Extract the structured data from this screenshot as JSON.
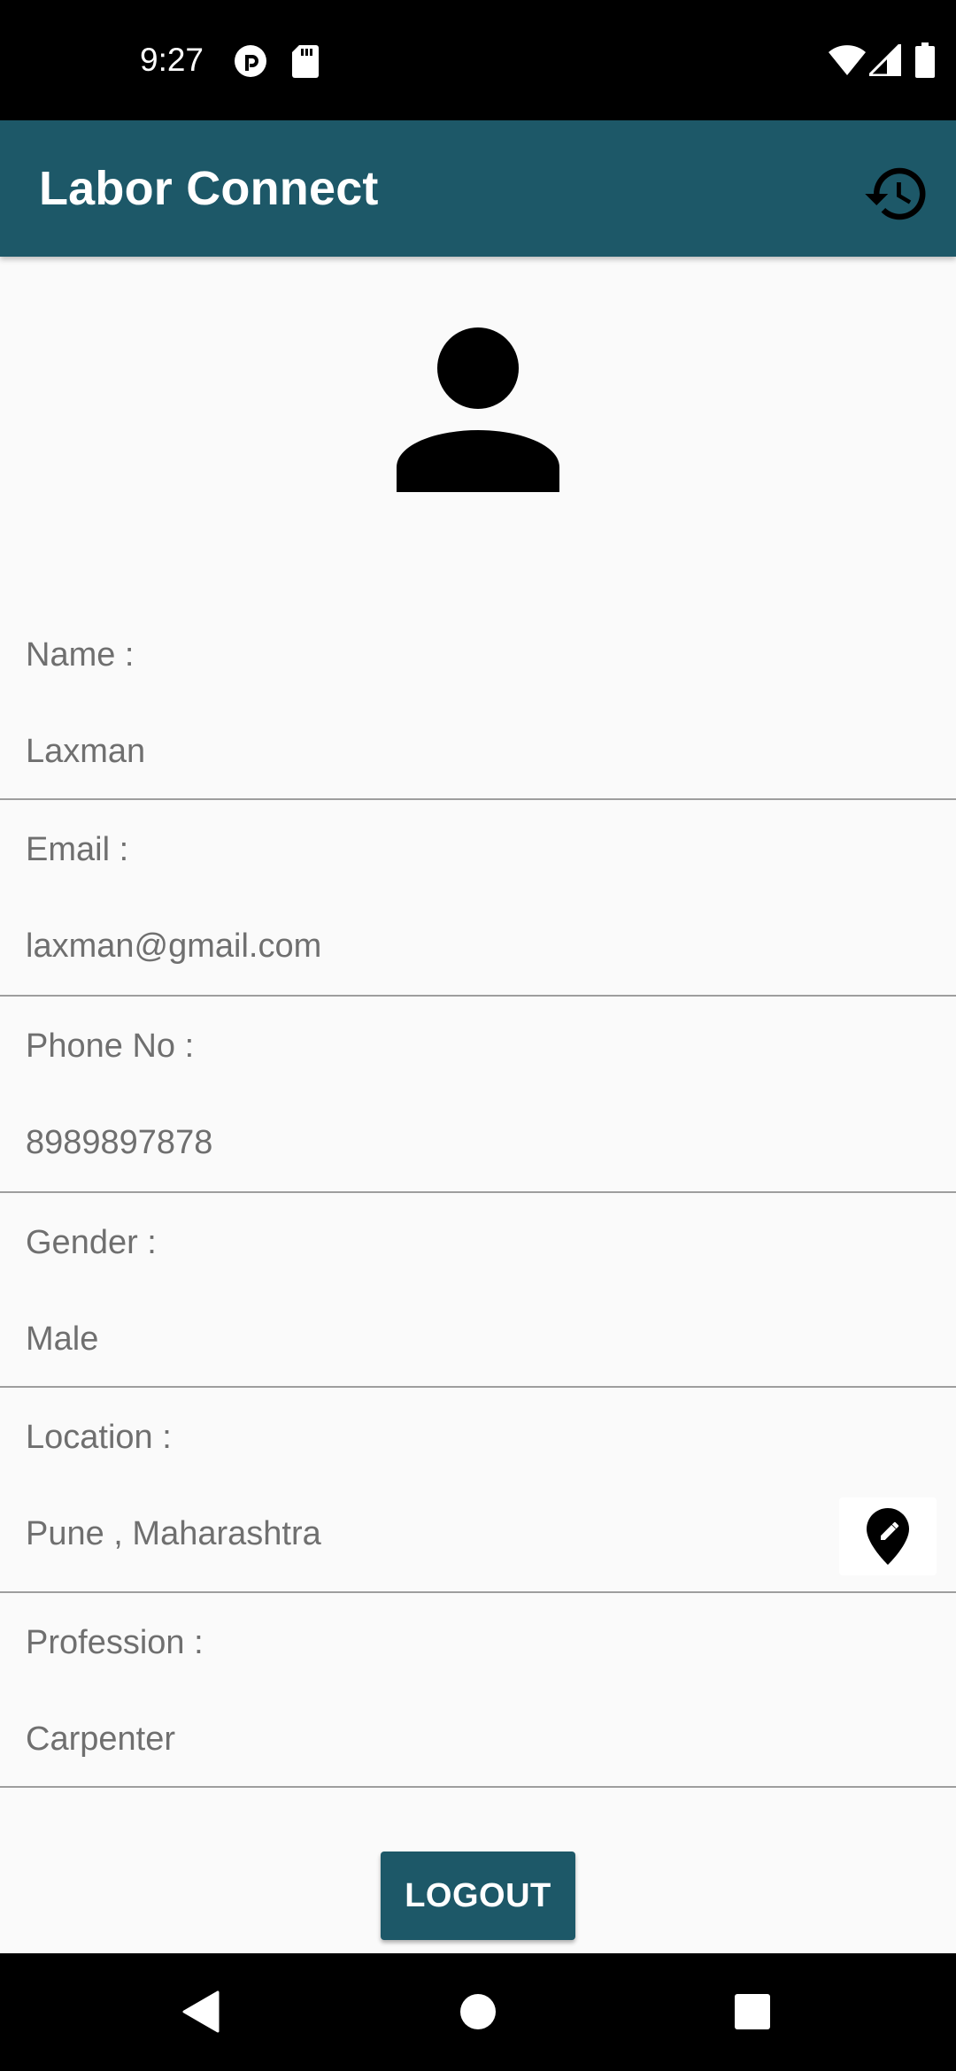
{
  "status_bar": {
    "time": "9:27",
    "icons": [
      "pocket-casts-icon",
      "sd-card-icon",
      "wifi-icon",
      "cellular-signal-icon",
      "battery-icon"
    ]
  },
  "app_bar": {
    "title": "Labor Connect",
    "action_icon": "history-icon"
  },
  "profile": {
    "avatar_icon": "person-icon",
    "fields": [
      {
        "label": "Name :",
        "value": "Laxman"
      },
      {
        "label": "Email :",
        "value": "laxman@gmail.com"
      },
      {
        "label": "Phone No :",
        "value": "8989897878"
      },
      {
        "label": "Gender :",
        "value": "Male"
      },
      {
        "label": "Location :",
        "value": "Pune , Maharashtra",
        "action_icon": "edit-location-icon"
      },
      {
        "label": "Profession :",
        "value": "Carpenter"
      }
    ]
  },
  "logout_label": "LOGOUT",
  "nav_bar": {
    "icons": [
      "back-icon",
      "home-icon",
      "recents-icon"
    ]
  },
  "colors": {
    "accent": "#1d5868",
    "background": "#fafafa",
    "text_secondary": "#6f6f6f",
    "divider": "#9e9e9e"
  }
}
